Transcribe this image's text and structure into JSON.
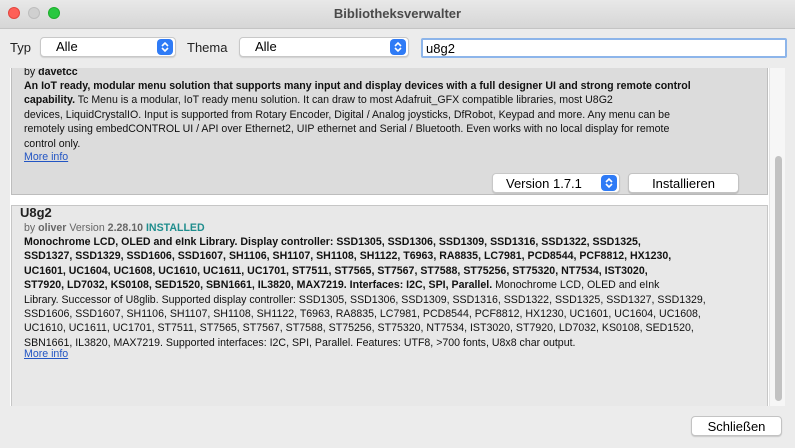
{
  "window": {
    "title": "Bibliotheksverwalter",
    "colors": {
      "close": "#fe5f57",
      "minimize": "#d0d0d0",
      "maximize": "#28c840",
      "accent": "#2f7bf6",
      "link": "#2255c4",
      "installed": "#1f8d8d"
    }
  },
  "filters": {
    "type_label": "Typ",
    "type_value": "Alle",
    "topic_label": "Thema",
    "topic_value": "Alle",
    "search_value": "u8g2"
  },
  "libraries": [
    {
      "by_prefix": "by",
      "author": "davetcc",
      "description_bold": "An IoT ready, modular menu solution that supports many input and display devices with a full designer UI and strong remote control capability.",
      "description_lines": [
        "Tc Menu is a modular, IoT ready menu solution. It can draw to most Adafruit_GFX compatible libraries, most U8G2",
        "devices, LiquidCrystalIO. Input is supported from Rotary Encoder, Digital / Analog joysticks, DfRobot, Keypad and more. Any menu can be",
        "remotely using embedCONTROL UI / API over Ethernet2, UIP ethernet and Serial / Bluetooth. Even works with no local display for remote",
        "control only."
      ],
      "more_info": "More info",
      "version_select": "Version 1.7.1",
      "install_label": "Installieren"
    },
    {
      "name": "U8g2",
      "by_prefix": "by",
      "author": "oliver",
      "version_label": "Version",
      "version": "2.28.10",
      "status": "INSTALLED",
      "description_bold_lines": [
        "Monochrome LCD, OLED and eInk Library. Display controller: SSD1305, SSD1306, SSD1309, SSD1316, SSD1322, SSD1325,",
        "SSD1327, SSD1329, SSD1606, SSD1607, SH1106, SH1107, SH1108, SH1122, T6963, RA8835, LC7981, PCD8544, PCF8812, HX1230,",
        "UC1601, UC1604, UC1608, UC1610, UC1611, UC1701, ST7511, ST7565, ST7567, ST7588, ST75256, ST75320, NT7534, IST3020,",
        "ST7920, LD7032, KS0108, SED1520, SBN1661, IL3820, MAX7219. Interfaces: I2C, SPI, Parallel."
      ],
      "description_tail_first": "Monochrome LCD, OLED and eInk",
      "description_lines": [
        "Library. Successor of U8glib. Supported display controller: SSD1305, SSD1306, SSD1309, SSD1316, SSD1322, SSD1325, SSD1327, SSD1329,",
        "SSD1606, SSD1607, SH1106, SH1107, SH1108, SH1122, T6963, RA8835, LC7981, PCD8544, PCF8812, HX1230, UC1601, UC1604, UC1608,",
        "UC1610, UC1611, UC1701, ST7511, ST7565, ST7567, ST7588, ST75256, ST75320, NT7534, IST3020, ST7920, LD7032, KS0108, SED1520,",
        "SBN1661, IL3820, MAX7219. Supported interfaces: I2C, SPI, Parallel. Features: UTF8, >700 fonts, U8x8 char output."
      ],
      "more_info": "More info"
    }
  ],
  "footer": {
    "close_label": "Schließen"
  }
}
